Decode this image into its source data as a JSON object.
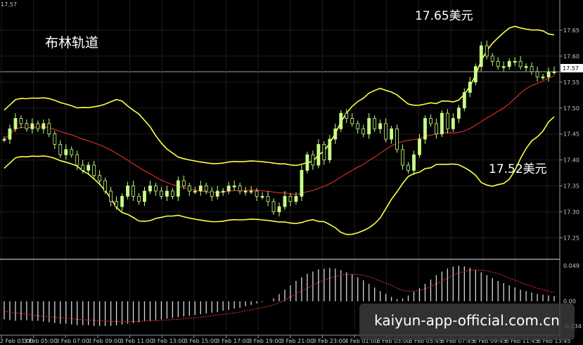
{
  "chart_data": [
    {
      "type": "candlestick",
      "title": "布林轨道",
      "annotations": [
        "17.65美元",
        "17.52美元"
      ],
      "current_price_label": "17.57",
      "corner_label": "17.57",
      "ylim": [
        17.21,
        17.7
      ],
      "y_ticks": [
        "17.65",
        "17.60",
        "17.55",
        "17.50",
        "17.45",
        "17.40",
        "17.35",
        "17.30",
        "17.25"
      ],
      "x_ticks": [
        "2 Feb 03:00",
        "3 Feb 05:00",
        "3 Feb 07:00",
        "3 Feb 09:00",
        "3 Feb 11:00",
        "3 Feb 13:00",
        "3 Feb 15:00",
        "3 Feb 17:00",
        "3 Feb 19:00",
        "3 Feb 21:00",
        "3 Feb 23:00",
        "4 Feb 01:00",
        "6 Feb 03:00",
        "6 Feb 05:45",
        "6 Feb 07:45",
        "6 Feb 09:45",
        "6 Feb 11:45",
        "6 Feb 13:45"
      ],
      "colors": {
        "background": "#000000",
        "candles": "#c8ff88",
        "bands": "#ffff44",
        "ma": "#ff3030",
        "grid": "#1e1e1e"
      },
      "closes": [
        17.44,
        17.46,
        17.48,
        17.47,
        17.46,
        17.47,
        17.46,
        17.47,
        17.45,
        17.43,
        17.41,
        17.42,
        17.41,
        17.39,
        17.38,
        17.39,
        17.37,
        17.36,
        17.34,
        17.32,
        17.31,
        17.33,
        17.35,
        17.33,
        17.32,
        17.34,
        17.35,
        17.34,
        17.33,
        17.34,
        17.33,
        17.36,
        17.35,
        17.34,
        17.34,
        17.35,
        17.34,
        17.33,
        17.34,
        17.34,
        17.35,
        17.35,
        17.34,
        17.34,
        17.34,
        17.33,
        17.33,
        17.32,
        17.3,
        17.31,
        17.33,
        17.32,
        17.33,
        17.38,
        17.41,
        17.39,
        17.43,
        17.4,
        17.44,
        17.46,
        17.49,
        17.48,
        17.47,
        17.46,
        17.45,
        17.48,
        17.46,
        17.47,
        17.44,
        17.46,
        17.42,
        17.39,
        17.38,
        17.41,
        17.44,
        17.48,
        17.47,
        17.45,
        17.49,
        17.46,
        17.48,
        17.5,
        17.53,
        17.55,
        17.58,
        17.62,
        17.6,
        17.59,
        17.58,
        17.58,
        17.59,
        17.59,
        17.58,
        17.58,
        17.57,
        17.56,
        17.56,
        17.57,
        17.57
      ]
    },
    {
      "type": "bar",
      "title": "MACD",
      "y_ticks": [
        "0.049",
        "0.00",
        "-0.034"
      ],
      "ylim": [
        -0.04,
        0.055
      ],
      "values": [
        -0.025,
        -0.026,
        -0.027,
        -0.026,
        -0.026,
        -0.027,
        -0.027,
        -0.028,
        -0.029,
        -0.03,
        -0.031,
        -0.031,
        -0.032,
        -0.033,
        -0.033,
        -0.033,
        -0.034,
        -0.034,
        -0.034,
        -0.034,
        -0.033,
        -0.032,
        -0.031,
        -0.03,
        -0.029,
        -0.028,
        -0.027,
        -0.026,
        -0.025,
        -0.024,
        -0.023,
        -0.022,
        -0.021,
        -0.02,
        -0.019,
        -0.018,
        -0.017,
        -0.016,
        -0.015,
        -0.013,
        -0.012,
        -0.01,
        -0.009,
        -0.007,
        -0.005,
        -0.003,
        -0.001,
        0.0,
        0.004,
        0.01,
        0.016,
        0.022,
        0.028,
        0.033,
        0.038,
        0.041,
        0.044,
        0.045,
        0.046,
        0.045,
        0.043,
        0.04,
        0.037,
        0.033,
        0.029,
        0.024,
        0.019,
        0.014,
        0.01,
        0.006,
        0.003,
        0.004,
        0.008,
        0.013,
        0.018,
        0.024,
        0.03,
        0.036,
        0.041,
        0.045,
        0.048,
        0.049,
        0.048,
        0.046,
        0.043,
        0.04,
        0.036,
        0.032,
        0.028,
        0.025,
        0.022,
        0.019,
        0.016,
        0.014,
        0.012,
        0.01,
        0.009,
        0.008,
        0.007
      ],
      "signal": [
        -0.014,
        -0.015,
        -0.016,
        -0.017,
        -0.018,
        -0.019,
        -0.02,
        -0.021,
        -0.021,
        -0.022,
        -0.023,
        -0.023,
        -0.024,
        -0.025,
        -0.025,
        -0.026,
        -0.026,
        -0.027,
        -0.027,
        -0.028,
        -0.028,
        -0.028,
        -0.028,
        -0.028,
        -0.028,
        -0.027,
        -0.027,
        -0.027,
        -0.026,
        -0.026,
        -0.025,
        -0.025,
        -0.024,
        -0.023,
        -0.023,
        -0.022,
        -0.021,
        -0.02,
        -0.019,
        -0.018,
        -0.017,
        -0.016,
        -0.015,
        -0.013,
        -0.012,
        -0.01,
        -0.009,
        -0.007,
        -0.005,
        -0.002,
        0.002,
        0.006,
        0.01,
        0.014,
        0.018,
        0.022,
        0.026,
        0.029,
        0.032,
        0.034,
        0.036,
        0.037,
        0.037,
        0.037,
        0.036,
        0.034,
        0.031,
        0.028,
        0.025,
        0.022,
        0.018,
        0.015,
        0.014,
        0.014,
        0.015,
        0.017,
        0.02,
        0.024,
        0.028,
        0.032,
        0.036,
        0.039,
        0.041,
        0.043,
        0.043,
        0.043,
        0.042,
        0.04,
        0.038,
        0.035,
        0.032,
        0.029,
        0.026,
        0.023,
        0.021,
        0.018,
        0.016,
        0.014,
        0.012
      ],
      "watermark": "kaiyun-app-official.com.cn"
    }
  ]
}
